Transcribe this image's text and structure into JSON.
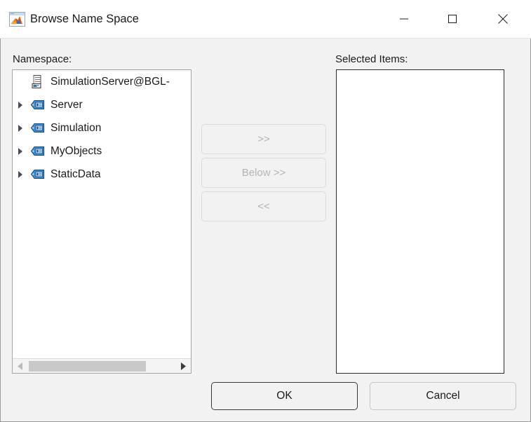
{
  "window": {
    "title": "Browse Name Space",
    "app_icon": "matlab-membrane-icon",
    "controls": {
      "minimize": "minimize-icon",
      "maximize": "maximize-icon",
      "close": "close-icon"
    }
  },
  "labels": {
    "namespace": "Namespace:",
    "selected_items": "Selected Items:"
  },
  "tree": {
    "items": [
      {
        "label": "SimulationServer@BGL-",
        "icon": "server-stack-icon",
        "expandable": false,
        "expanded": false,
        "clipped": true
      },
      {
        "label": "Server",
        "icon": "namespace-tag-icon",
        "expandable": true,
        "expanded": false,
        "clipped": false
      },
      {
        "label": "Simulation",
        "icon": "namespace-tag-icon",
        "expandable": true,
        "expanded": false,
        "clipped": false
      },
      {
        "label": "MyObjects",
        "icon": "namespace-tag-icon",
        "expandable": true,
        "expanded": false,
        "clipped": false
      },
      {
        "label": "StaticData",
        "icon": "namespace-tag-icon",
        "expandable": true,
        "expanded": false,
        "clipped": false
      }
    ],
    "scrollbar": {
      "orientation": "horizontal",
      "left_arrow": "scroll-left-arrow-icon",
      "right_arrow": "scroll-right-arrow-icon",
      "left_enabled": false,
      "right_enabled": true
    }
  },
  "transfer_buttons": [
    {
      "label": ">>",
      "enabled": false
    },
    {
      "label": "Below >>",
      "enabled": false
    },
    {
      "label": "<<",
      "enabled": false
    }
  ],
  "selected_items": {
    "items": []
  },
  "dialog_buttons": {
    "ok": "OK",
    "cancel": "Cancel"
  },
  "colors": {
    "window_bg": "#f2f2f2",
    "panel_bg": "#ffffff",
    "titlebar_bg": "#ffffff",
    "text": "#1b1b1b",
    "disabled_text": "#b4b4b4",
    "tree_border": "#a6a6a6",
    "selected_border": "#2b2b2b",
    "scroll_thumb": "#c8c8c8",
    "icon_blue": "#2a6fc0"
  }
}
